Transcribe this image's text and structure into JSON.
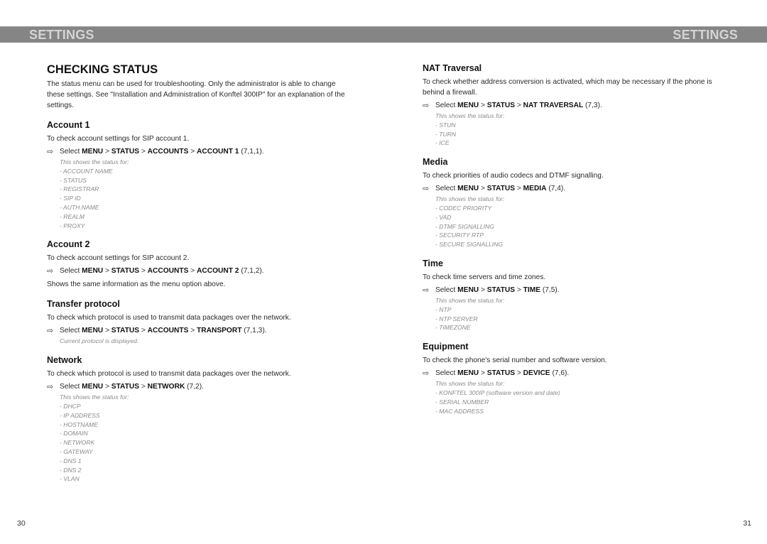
{
  "header": {
    "left_title": "SETTINGS",
    "right_title": "SETTINGS"
  },
  "left_page": {
    "title": "CHECKING STATUS",
    "intro": "The status menu can be used for troubleshooting. Only the administrator is able to change these settings. See \"Installation and Administration of Konftel 300IP\" for an explanation of the settings.",
    "sections": [
      {
        "heading": "Account 1",
        "description": "To check account settings for SIP account 1.",
        "step": {
          "prefix": "Select",
          "path": [
            "MENU",
            "STATUS",
            "ACCOUNTS",
            "ACCOUNT 1"
          ],
          "code": "(7,1,1)."
        },
        "note_intro": "This shows the status for:",
        "items": [
          "- ACCOUNT NAME",
          "- STATUS",
          "- REGISTRAR",
          "- SIP ID",
          "- AUTH.NAME",
          "- REALM",
          "- PROXY"
        ]
      },
      {
        "heading": "Account 2",
        "description": "To check account settings for SIP account 2.",
        "step": {
          "prefix": "Select",
          "path": [
            "MENU",
            "STATUS",
            "ACCOUNTS",
            "ACCOUNT 2"
          ],
          "code": "(7,1,2)."
        },
        "after": "Shows the same information as the menu option above."
      },
      {
        "heading": "Transfer protocol",
        "description": "To check which protocol is used to transmit data packages over the network.",
        "step": {
          "prefix": "Select",
          "path": [
            "MENU",
            "STATUS",
            "ACCOUNTS",
            "TRANSPORT"
          ],
          "code": "(7,1,3)."
        },
        "note_intro": "Current protocol is displayed."
      },
      {
        "heading": "Network",
        "description": "To check which protocol is used to transmit data packages over the network.",
        "step": {
          "prefix": "Select",
          "path": [
            "MENU",
            "STATUS",
            "NETWORK"
          ],
          "code": "(7,2)."
        },
        "note_intro": "This shows the status for:",
        "items": [
          "- DHCP",
          "- IP ADDRESS",
          "- HOSTNAME",
          "- DOMAIN",
          "- NETWORK",
          "- GATEWAY",
          "- DNS 1",
          "- DNS 2",
          "- VLAN"
        ]
      }
    ],
    "page_number": "30"
  },
  "right_page": {
    "sections": [
      {
        "heading": "NAT Traversal",
        "description": "To check whether address conversion is activated, which may be necessary if the phone is behind a firewall.",
        "step": {
          "prefix": "Select",
          "path": [
            "MENU",
            "STATUS",
            "NAT TRAVERSAL"
          ],
          "code": "(7,3)."
        },
        "note_intro": "This shows the status for:",
        "items": [
          "- STUN",
          "- TURN",
          "- ICE"
        ]
      },
      {
        "heading": "Media",
        "description": "To check priorities of audio codecs and DTMF signalling.",
        "step": {
          "prefix": "Select",
          "path": [
            "MENU",
            "STATUS",
            "MEDIA"
          ],
          "code": "(7,4)."
        },
        "note_intro": "This shows the status for:",
        "items": [
          "- CODEC PRIORITY",
          "- VAD",
          "- DTMF SIGNALLING",
          "- SECURITY RTP",
          "- SECURE SIGNALLING"
        ]
      },
      {
        "heading": "Time",
        "description": "To check time servers and time zones.",
        "step": {
          "prefix": "Select",
          "path": [
            "MENU",
            "STATUS",
            "TIME"
          ],
          "code": "(7,5)."
        },
        "note_intro": "This shows the status for:",
        "items": [
          "- NTP",
          "- NTP SERVER",
          "- TIMEZONE"
        ]
      },
      {
        "heading": "Equipment",
        "description": "To check the phone's serial number and software version.",
        "step": {
          "prefix": "Select",
          "path": [
            "MENU",
            "STATUS",
            "DEVICE"
          ],
          "code": "(7,6)."
        },
        "note_intro": "This shows the status for:",
        "items": [
          "- KONFTEL 300IP (software version and date)",
          "- SERIAL NUMBER",
          "- MAC ADDRESS"
        ]
      }
    ],
    "page_number": "31"
  },
  "icons": {
    "step_arrow": "arrow-right-outline-icon"
  },
  "colors": {
    "header_bar": "#858585",
    "header_text": "#d4d4d4",
    "note_text": "#8a8a8a"
  }
}
